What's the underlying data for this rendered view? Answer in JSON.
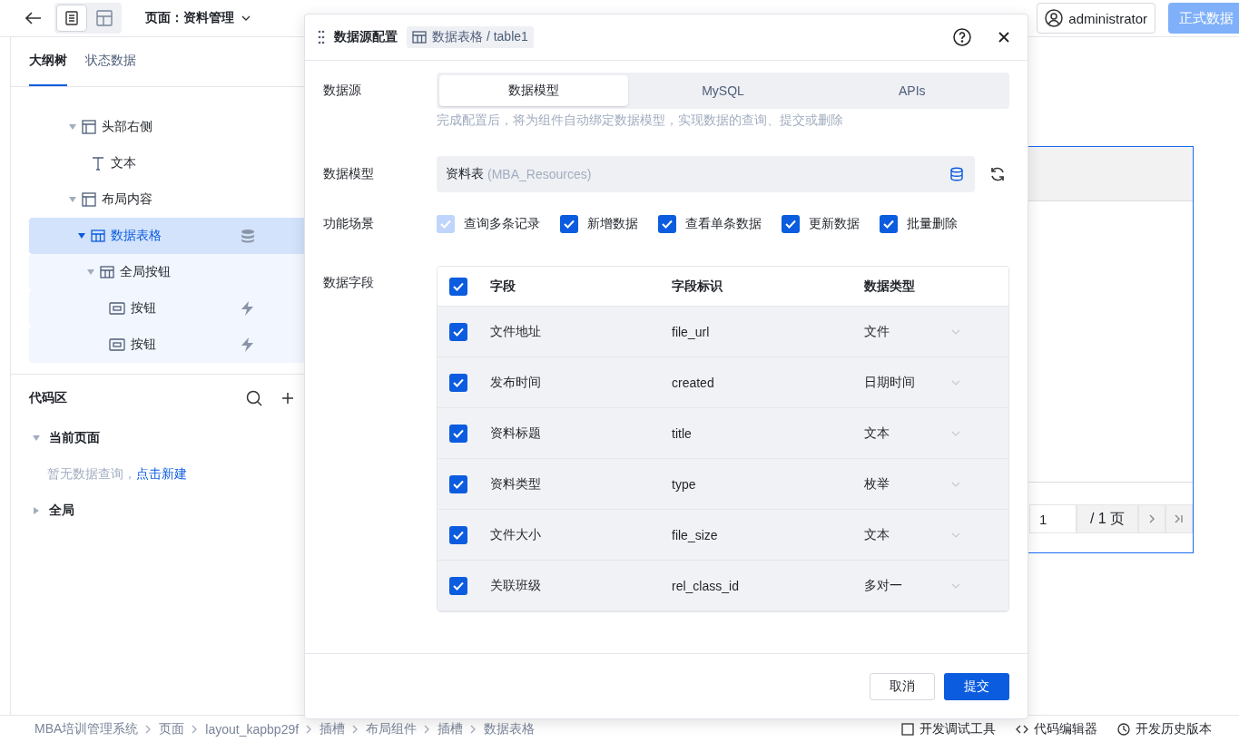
{
  "topbar": {
    "view_modes": [
      {
        "selected": true
      },
      {
        "selected": false
      }
    ],
    "page_title": "页面：资料管理",
    "user": "administrator",
    "publish_button": "正式数据"
  },
  "sidebar": {
    "tabs": [
      {
        "label": "大纲树",
        "selected": true
      },
      {
        "label": "状态数据",
        "selected": false
      }
    ],
    "tree": [
      {
        "label": "头部右侧",
        "kind": "layout",
        "expanded": true,
        "selected": false,
        "children": [
          {
            "label": "文本",
            "kind": "text",
            "selected": false
          }
        ]
      },
      {
        "label": "布局内容",
        "kind": "layout",
        "expanded": true,
        "selected": false,
        "children": [
          {
            "label": "数据表格",
            "kind": "table",
            "expanded": true,
            "selected": true,
            "bound_data": true,
            "children": [
              {
                "label": "全局按钮",
                "kind": "table",
                "expanded": true,
                "selected": false,
                "children": [
                  {
                    "label": "按钮",
                    "kind": "button",
                    "selected": false,
                    "has_event": true
                  },
                  {
                    "label": "按钮",
                    "kind": "button",
                    "selected": false,
                    "has_event": true
                  }
                ]
              }
            ]
          }
        ]
      }
    ],
    "code_area": {
      "title": "代码区",
      "groups": [
        {
          "label": "当前页面",
          "expanded": true,
          "empty_text": "暂无数据查询，",
          "link": "点击新建"
        },
        {
          "label": "全局",
          "expanded": false
        }
      ]
    }
  },
  "canvas": {
    "page_input": "1",
    "page_total": "/ 1 页"
  },
  "footer": {
    "breadcrumb": [
      "MBA培训管理系统",
      "页面",
      "layout_kapbp29f",
      "插槽",
      "布局组件",
      "插槽",
      "数据表格"
    ],
    "tools": [
      "开发调试工具",
      "代码编辑器",
      "开发历史版本"
    ]
  },
  "dialog": {
    "title": "数据源配置",
    "component_tag": "数据表格 / table1",
    "source_label": "数据源",
    "source_tabs": [
      {
        "label": "数据模型",
        "selected": true
      },
      {
        "label": "MySQL",
        "selected": false
      },
      {
        "label": "APIs",
        "selected": false
      }
    ],
    "hint": "完成配置后，将为组件自动绑定数据模型，实现数据的查询、提交或删除",
    "model_label": "数据模型",
    "model_name": "资料表",
    "model_id": "(MBA_Resources)",
    "scenes_label": "功能场景",
    "scenes": [
      {
        "label": "查询多条记录",
        "checked": true,
        "disabled": true
      },
      {
        "label": "新增数据",
        "checked": true,
        "disabled": false
      },
      {
        "label": "查看单条数据",
        "checked": true,
        "disabled": false
      },
      {
        "label": "更新数据",
        "checked": true,
        "disabled": false
      },
      {
        "label": "批量删除",
        "checked": true,
        "disabled": false
      }
    ],
    "fields_label": "数据字段",
    "columns": [
      "字段",
      "字段标识",
      "数据类型"
    ],
    "all_checked": true,
    "fields": [
      {
        "name": "文件地址",
        "id": "file_url",
        "type": "文件",
        "checked": true
      },
      {
        "name": "发布时间",
        "id": "created",
        "type": "日期时间",
        "checked": true
      },
      {
        "name": "资料标题",
        "id": "title",
        "type": "文本",
        "checked": true
      },
      {
        "name": "资料类型",
        "id": "type",
        "type": "枚举",
        "checked": true
      },
      {
        "name": "文件大小",
        "id": "file_size",
        "type": "文本",
        "checked": true
      },
      {
        "name": "关联班级",
        "id": "rel_class_id",
        "type": "多对一",
        "checked": true
      }
    ],
    "cancel": "取消",
    "submit": "提交"
  }
}
